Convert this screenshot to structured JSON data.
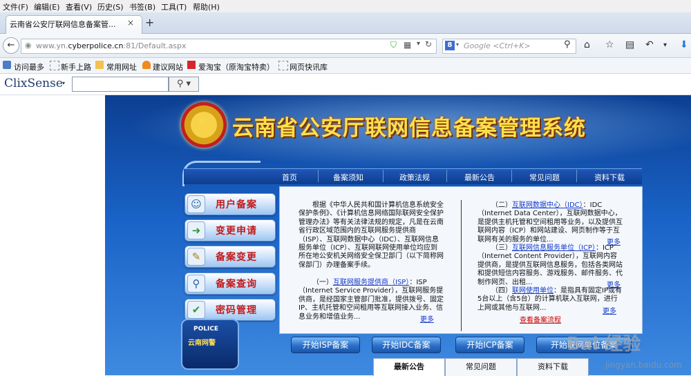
{
  "menu": [
    "文件(F)",
    "编辑(E)",
    "查看(V)",
    "历史(S)",
    "书签(B)",
    "工具(T)",
    "帮助(H)"
  ],
  "tab": {
    "title": "云南省公安厅联网信息备案管...",
    "close": "×",
    "new": "+"
  },
  "nav": {
    "url_prefix": "www.yn.",
    "url_domain": "cyberpolice.cn",
    "url_suffix": ":81/Default.aspx",
    "search_placeholder": "Google <Ctrl+K>",
    "search_engine_letter": "8"
  },
  "bookmarks": [
    "访问最多",
    "新手上路",
    "常用网址",
    "建议网站",
    "爱淘宝（原淘宝特卖）",
    "网页快讯库"
  ],
  "clix": {
    "logo": "ClixSense"
  },
  "site": {
    "title": "云南省公安厅联网信息备案管理系统",
    "nav_links": [
      "首页",
      "备案须知",
      "政策法规",
      "最新公告",
      "常见问题",
      "资料下载"
    ],
    "side_buttons": [
      "用户备案",
      "变更申请",
      "备案变更",
      "备案查询",
      "密码管理"
    ],
    "badge_top": "POLICE",
    "badge_sub": "云南网警"
  },
  "content": {
    "left_intro": "根据《中华人民共和国计算机信息系统安全保护条例》、《计算机信息网络国际联网安全保护管理办法》等有关法律法规的规定，凡是在云南省行政区域范围内的互联网服务提供商（ISP）、互联网数据中心（IDC）、互联网信息服务单位（ICP）、互联网联网使用单位均应到所在地公安机关网络安全保卫部门（以下简称网保部门）办理备案手续。",
    "isp_prefix": "（一）",
    "isp_link": "互联网服务提供商（ISP）",
    "isp_text": "：ISP（Internet Service Provider），互联网服务提供商，是经国家主管部门批准，提供拨号、固定IP、主机托管和空间租用等互联网接入业务、信息业务和增值业务...",
    "idc_prefix": "（二）",
    "idc_link": "互联网数据中心（IDC）",
    "idc_text": "：IDC（Internet Data Center），互联网数据中心，是提供主机托管和空间租用等业务，以及提供互联网内容（ICP）和网站建设、网页制作等于互联网有关的服务的单位...",
    "icp_prefix": "（三）",
    "icp_link": "互联网信息服务单位（ICP）",
    "icp_text": "：ICP（Internet Content Provider），互联网内容提供商，是提供互联网信息服务，包括各类网站和提供短信内容服务、游戏服务、邮件服务、代制作网页、出租...",
    "user_prefix": "（四）",
    "user_link": "联网使用单位",
    "user_text": "：是指具有固定IP或有5台以上（含5台）的计算机联入互联网，进行上网或其他与互联网...",
    "more": "更多",
    "flow_link": "查看备案流程"
  },
  "actions": [
    "开始ISP备案",
    "开始IDC备案",
    "开始ICP备案",
    "开始联网单位备案"
  ],
  "bottom_tabs": [
    "最新公告",
    "常见问题",
    "资料下载"
  ],
  "watermark": {
    "logo": "Bai 经验",
    "site": "jingyan.baidu.com"
  },
  "colors": {
    "title": "#ffe04a",
    "accent": "#1538c7",
    "button_label": "#c21b1b",
    "page_bg": "#1a63c8"
  }
}
